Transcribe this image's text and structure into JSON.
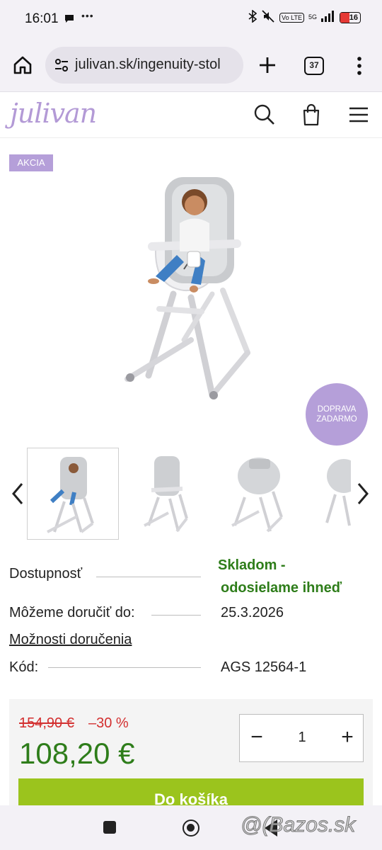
{
  "status_bar": {
    "time": "16:01",
    "more": "•••",
    "volte": "Vo LTE",
    "network": "5G",
    "battery": "16"
  },
  "browser": {
    "url": "julivan.sk/ingenuity-stol",
    "tab_count": "37"
  },
  "site": {
    "logo": "julivan",
    "brand_color": "#b39ad6"
  },
  "product": {
    "sale_badge": "AKCIA",
    "shipping_badge_line1": "DOPRAVA",
    "shipping_badge_line2": "ZADARMO"
  },
  "info": {
    "availability_label": "Dostupnosť",
    "availability_line1": "Skladom -",
    "availability_line2": "odosielame ihneď",
    "delivery_label": "Môžeme doručiť do:",
    "delivery_date": "25.3.2026",
    "delivery_options_link": "Možnosti doručenia",
    "code_label": "Kód:",
    "code_value": "AGS 12564-1"
  },
  "pricing": {
    "old_price": "154,90 €",
    "discount": "–30 %",
    "price": "108,20 €",
    "quantity": "1",
    "minus": "−",
    "plus": "+",
    "add_to_cart": "Do košíka",
    "price_color": "#2e7d1a",
    "discount_color": "#d32f2f",
    "button_color": "#9bc41d"
  },
  "watermark": "@(Bazos.sk"
}
